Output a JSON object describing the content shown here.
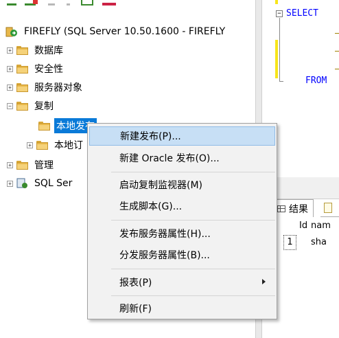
{
  "explorer": {
    "server_node": "FIREFLY (SQL Server 10.50.1600 - FIREFLY",
    "nodes": {
      "databases": "数据库",
      "security": "安全性",
      "server_objects": "服务器对象",
      "replication": "复制",
      "local_publications": "本地发布",
      "local_subscriptions": "本地订",
      "management": "管理",
      "sql_server_agent": "SQL Ser"
    },
    "expander_plus": "+",
    "expander_minus": "−"
  },
  "editor": {
    "collapse_symbol": "−",
    "keyword_select": "SELECT",
    "keyword_from": "FROM"
  },
  "results": {
    "tab_results": "结果",
    "columns": [
      "Id",
      "nam"
    ],
    "rows": [
      [
        "1",
        "sha"
      ]
    ]
  },
  "context_menu": {
    "items": [
      "新建发布(P)...",
      "新建 Oracle 发布(O)...",
      "启动复制监视器(M)",
      "生成脚本(G)...",
      "发布服务器属性(H)...",
      "分发服务器属性(B)...",
      "报表(P)",
      "刷新(F)"
    ],
    "hovered_index": 0
  },
  "colors": {
    "selection": "#0a7ad8",
    "menu_hover": "#c7dff5",
    "keyword": "#0000ff",
    "folder": "#e8b84a"
  }
}
